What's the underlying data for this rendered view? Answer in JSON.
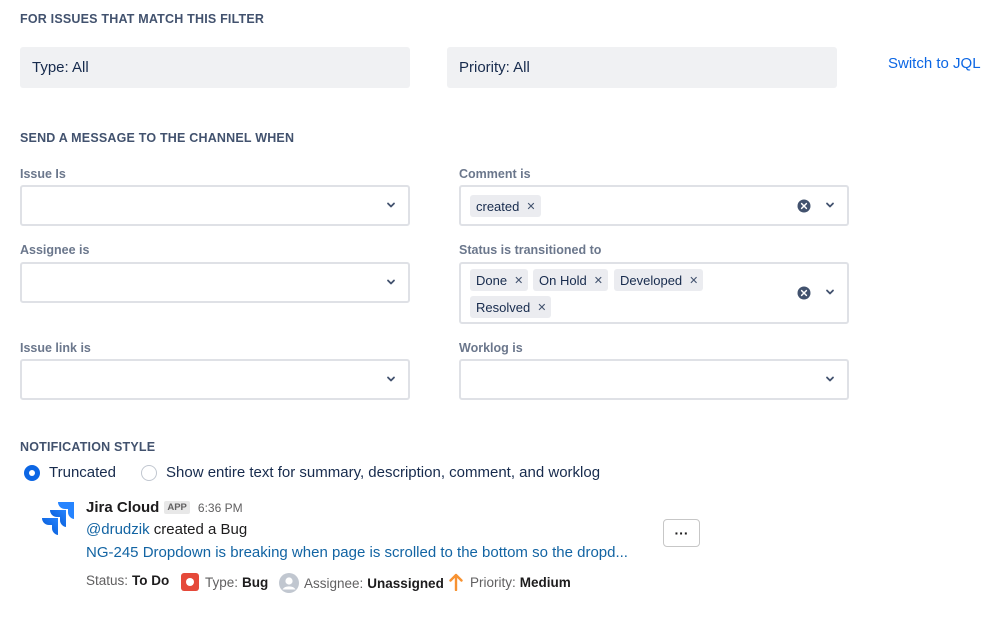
{
  "filter": {
    "section_title": "FOR ISSUES THAT MATCH THIS FILTER",
    "type_label": "Type: All",
    "priority_label": "Priority: All",
    "switch_link": "Switch to JQL"
  },
  "send": {
    "section_title": "SEND A MESSAGE TO THE CHANNEL WHEN",
    "issue_is": {
      "label": "Issue Is"
    },
    "comment_is": {
      "label": "Comment is",
      "chips": [
        "created"
      ]
    },
    "assignee_is": {
      "label": "Assignee is"
    },
    "status_transitioned": {
      "label": "Status is transitioned to",
      "chips": [
        "Done",
        "On Hold",
        "Developed",
        "Resolved"
      ]
    },
    "issue_link_is": {
      "label": "Issue link is"
    },
    "worklog_is": {
      "label": "Worklog is"
    }
  },
  "notification": {
    "section_title": "NOTIFICATION STYLE",
    "options": [
      {
        "label": "Truncated",
        "selected": true
      },
      {
        "label": "Show entire text for summary, description, comment, and worklog",
        "selected": false
      }
    ]
  },
  "preview": {
    "app_name": "Jira Cloud",
    "app_badge": "APP",
    "time": "6:36 PM",
    "mention": "@drudzik",
    "action": " created a Bug",
    "issue_link": "NG-245 Dropdown is breaking when page is scrolled to the bottom so the dropd...",
    "more_label": "···",
    "meta": {
      "status_label": "Status:",
      "status_value": "To Do",
      "type_label": "Type:",
      "type_value": "Bug",
      "assignee_label": "Assignee:",
      "assignee_value": "Unassigned",
      "priority_label": "Priority:",
      "priority_value": "Medium"
    }
  },
  "colors": {
    "link": "#0b66e4",
    "slack_link": "#1264a3",
    "bug": "#e5493a",
    "priority_medium": "#f79232",
    "jira_blue": "#2684ff"
  },
  "icons": {
    "chevron": "chevron-down-icon",
    "clear": "clear-icon",
    "logo": "jira-logo-icon",
    "bug": "bug-icon",
    "avatar": "avatar-icon",
    "priority": "arrow-up-icon"
  }
}
